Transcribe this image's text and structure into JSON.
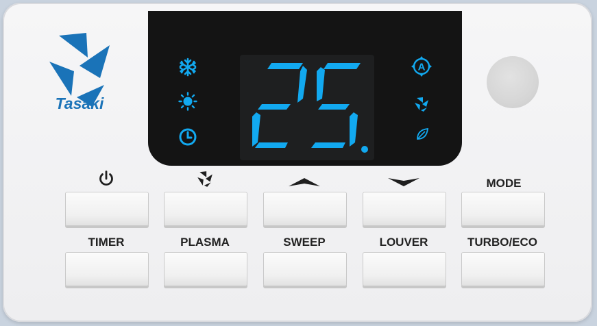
{
  "brand": {
    "name": "Tasaki",
    "color": "#1a73b8"
  },
  "display": {
    "temperature": "25",
    "lcd_color": "#12a9f0",
    "left_indicators": [
      "snowflake-icon",
      "sun-icon",
      "clock-icon"
    ],
    "right_indicators": [
      "auto-mode-icon",
      "fan-icon",
      "leaf-icon"
    ]
  },
  "top_row": {
    "power_icon": "power-icon",
    "fan_icon": "fan-icon",
    "up_icon": "chevron-up-icon",
    "down_icon": "chevron-down-icon",
    "mode_label": "MODE"
  },
  "bottom_row": {
    "timer_label": "TIMER",
    "plasma_label": "PLASMA",
    "sweep_label": "SWEEP",
    "louver_label": "LOUVER",
    "turbo_label": "TURBO/ECO"
  }
}
